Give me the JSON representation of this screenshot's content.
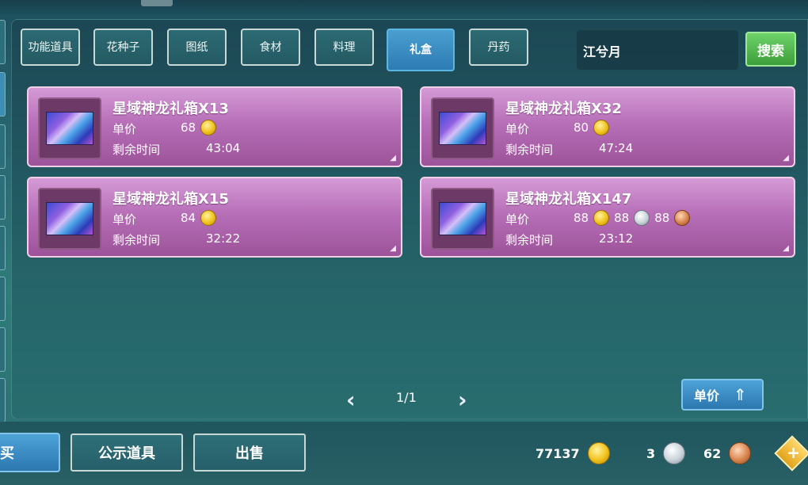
{
  "categories": [
    {
      "label": "功能道具",
      "active": false
    },
    {
      "label": "花种子",
      "active": false
    },
    {
      "label": "图纸",
      "active": false
    },
    {
      "label": "食材",
      "active": false
    },
    {
      "label": "料理",
      "active": false
    },
    {
      "label": "礼盒",
      "active": true
    },
    {
      "label": "丹药",
      "active": false
    }
  ],
  "search": {
    "value": "江兮月",
    "button_label": "搜索"
  },
  "listing": {
    "price_label": "单价",
    "time_label": "剩余时间",
    "items": [
      {
        "name": "星域神龙礼箱X13",
        "prices": [
          {
            "amount": "68",
            "currency": "gold"
          }
        ],
        "time_left": "43:04"
      },
      {
        "name": "星域神龙礼箱X32",
        "prices": [
          {
            "amount": "80",
            "currency": "gold"
          }
        ],
        "time_left": "47:24"
      },
      {
        "name": "星域神龙礼箱X15",
        "prices": [
          {
            "amount": "84",
            "currency": "gold"
          }
        ],
        "time_left": "32:22"
      },
      {
        "name": "星域神龙礼箱X147",
        "prices": [
          {
            "amount": "88",
            "currency": "gold"
          },
          {
            "amount": "88",
            "currency": "silver"
          },
          {
            "amount": "88",
            "currency": "bronze"
          }
        ],
        "time_left": "23:12"
      }
    ]
  },
  "pagination": {
    "current": "1/1"
  },
  "sort": {
    "label": "单价"
  },
  "bottom": {
    "buy_label": "购买",
    "public_label": "公示道具",
    "sell_label": "出售"
  },
  "wallet": {
    "gold": "77137",
    "silver": "3",
    "bronze": "62"
  },
  "colors": {
    "card_bg": "#b76fb8",
    "active_tab": "#2d7bb3",
    "search_button": "#3b9e39"
  }
}
